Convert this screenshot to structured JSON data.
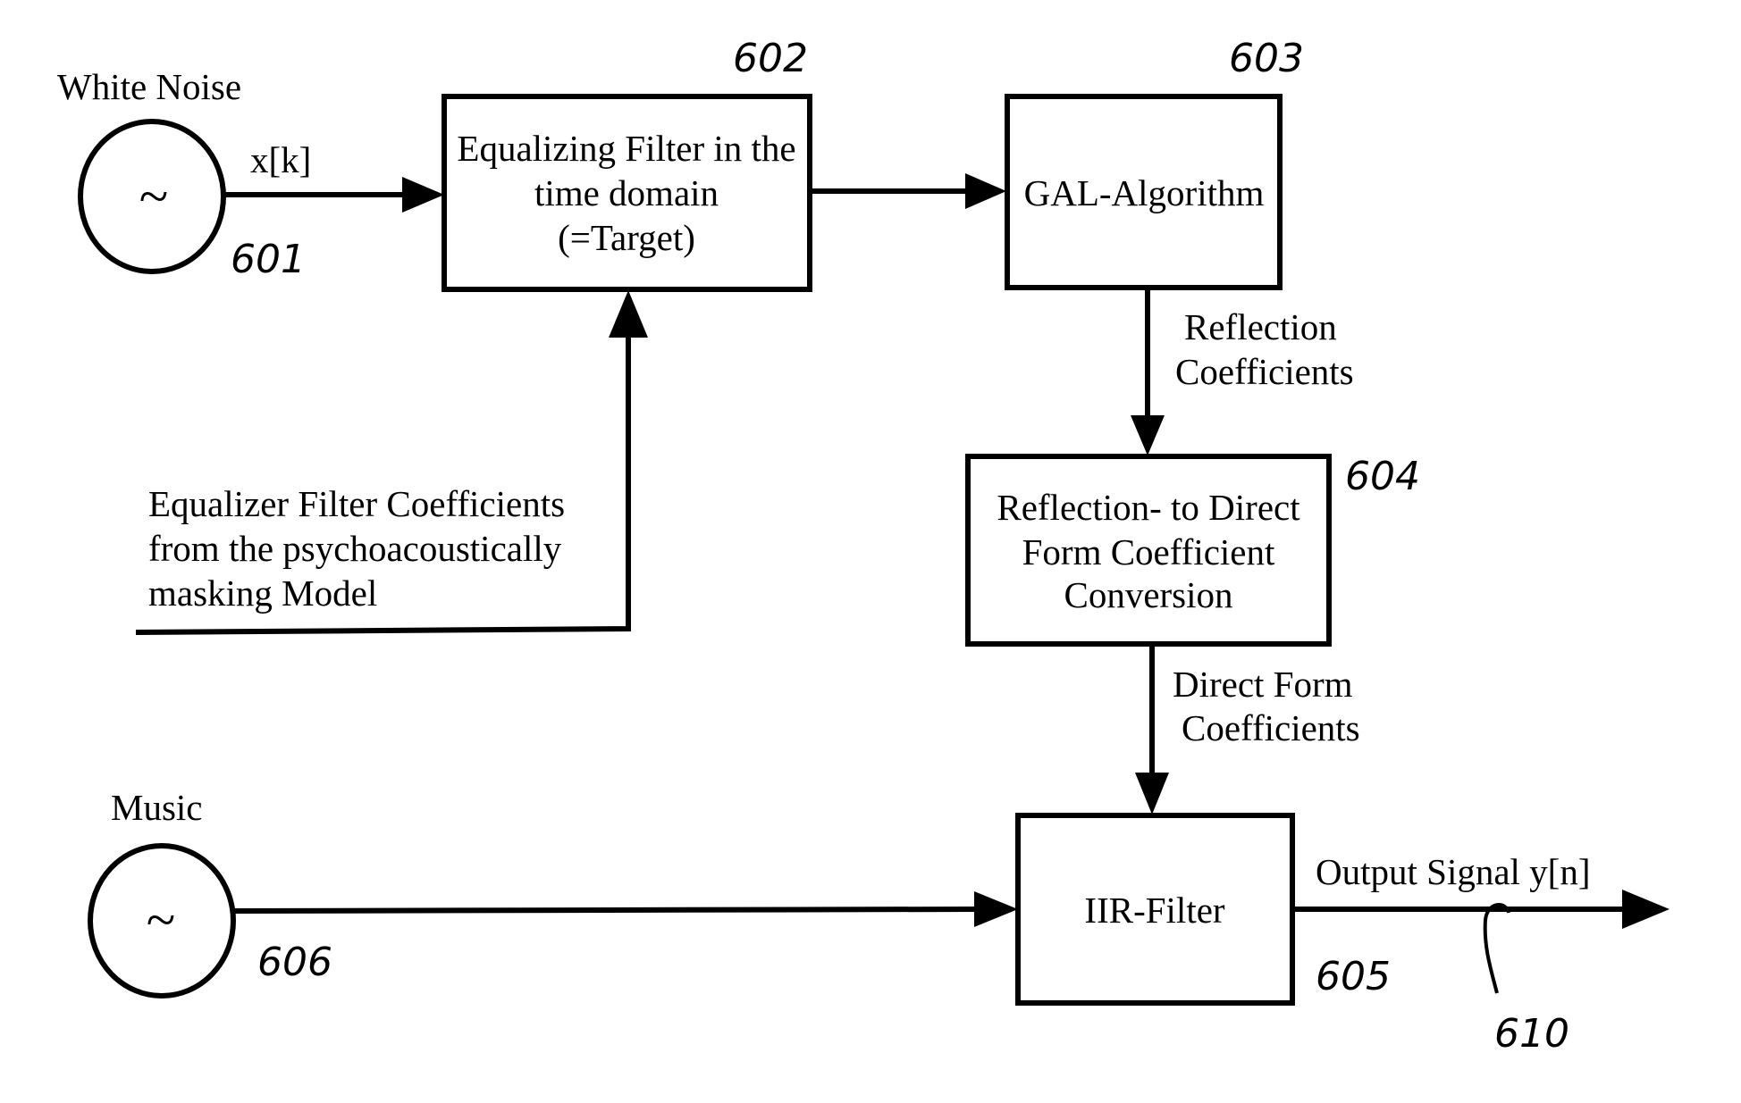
{
  "diagram": {
    "sources": {
      "white_noise": {
        "label": "White Noise",
        "symbol": "~",
        "ref": "601",
        "signal": "x[k]"
      },
      "music": {
        "label": "Music",
        "symbol": "~",
        "ref": "606"
      }
    },
    "blocks": {
      "equalizing_filter": {
        "lines": [
          "Equalizing Filter in the",
          "time domain",
          "(=Target)"
        ],
        "ref": "602"
      },
      "gal_algorithm": {
        "lines": [
          "GAL-Algorithm"
        ],
        "ref": "603"
      },
      "conversion": {
        "lines": [
          "Reflection- to Direct",
          "Form Coefficient",
          "Conversion"
        ],
        "ref": "604"
      },
      "iir_filter": {
        "lines": [
          "IIR-Filter"
        ],
        "ref": "605"
      }
    },
    "edge_labels": {
      "reflection_coefficients": [
        "Reflection",
        "Coefficients"
      ],
      "direct_form_coefficients": [
        "Direct Form",
        "Coefficients"
      ],
      "equalizer_coefficients": [
        "Equalizer Filter Coefficients",
        "from the psychoacoustically",
        "masking Model"
      ],
      "output": "Output Signal y[n]",
      "output_ref": "610"
    }
  }
}
